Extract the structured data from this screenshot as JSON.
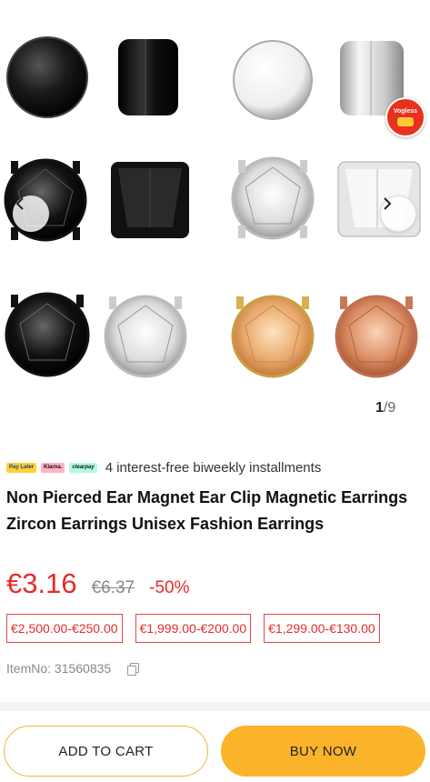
{
  "gallery": {
    "current_index": "1",
    "total": "/9",
    "badge_text": "Vogless"
  },
  "payment": {
    "logos": [
      "Pay Later",
      "Klarna.",
      "clearpay"
    ],
    "text": "4 interest-free biweekly installments"
  },
  "product": {
    "title": "Non Pierced Ear Magnet Ear Clip Magnetic Earrings Zircon Earrings Unisex Fashion Earrings",
    "price": "€3.16",
    "old_price": "€6.37",
    "discount": "-50%",
    "item_no": "ItemNo: 31560835"
  },
  "coupons": [
    "€2,500.00-€250.00",
    "€1,999.00-€200.00",
    "€1,299.00-€130.00"
  ],
  "actions": {
    "add_to_cart": "ADD TO CART",
    "buy_now": "BUY NOW"
  },
  "colors": {
    "accent": "#fbb32a",
    "price_red": "#e82a2a"
  }
}
